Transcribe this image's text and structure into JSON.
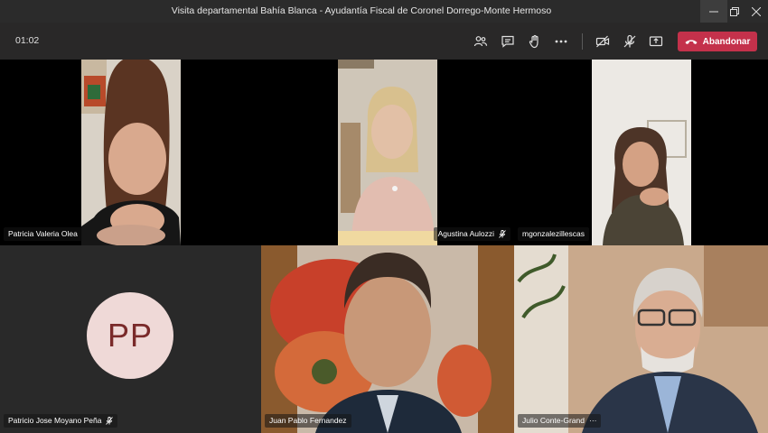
{
  "window": {
    "title": "Visita departamental Bahía Blanca - Ayudantía Fiscal de Coronel Dorrego-Monte Hermoso"
  },
  "toolbar": {
    "timer": "01:02",
    "leave_label": "Abandonar",
    "icons": [
      "participants-icon",
      "chat-icon",
      "raise-hand-icon",
      "more-actions-icon",
      "camera-off-icon",
      "mic-off-icon",
      "share-screen-icon",
      "phone-hangup-icon"
    ]
  },
  "participants": [
    {
      "name": "Patricia Valeria Olea",
      "muted": false
    },
    {
      "name": "Agustina Aulozzi",
      "muted": true
    },
    {
      "name": "mgonzalezillescas",
      "muted": false
    },
    {
      "name": "Patricio Jose Moyano Peña",
      "muted": true,
      "initials": "PP"
    },
    {
      "name": "Juan Pablo Fernandez",
      "muted": false
    },
    {
      "name": "Julio Conte-Grand",
      "muted": false,
      "more": "···"
    }
  ],
  "colors": {
    "leave": "#c4314b",
    "avatar_bg": "#efd9d7",
    "avatar_text": "#7a2a2a"
  }
}
